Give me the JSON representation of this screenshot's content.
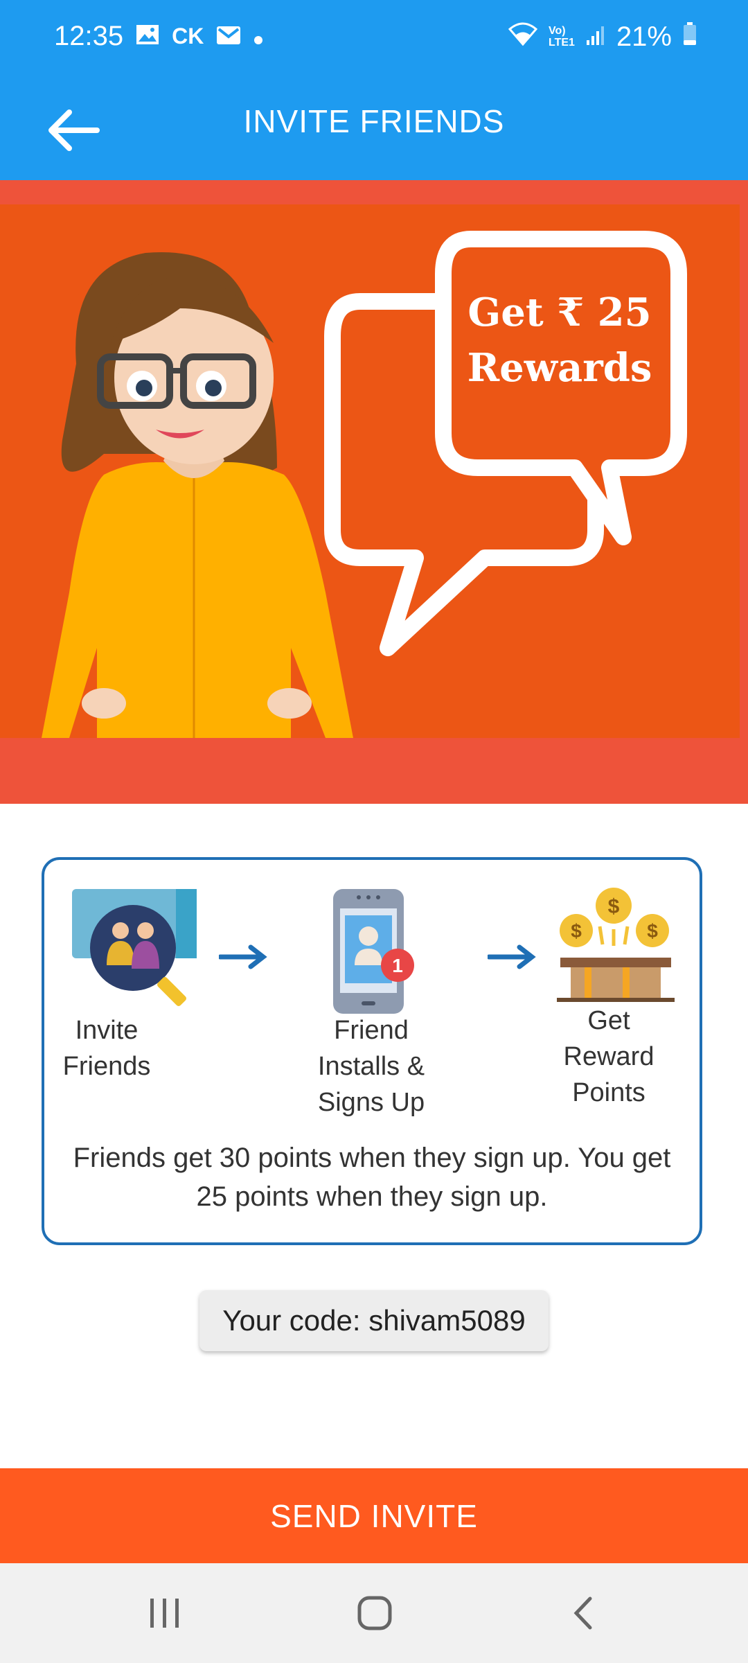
{
  "status_bar": {
    "time": "12:35",
    "carrier_text": "CK",
    "network_small_top": "Vo)",
    "network_small_bottom": "LTE1",
    "battery": "21%",
    "icons": [
      "image-icon",
      "gmail-icon",
      "dot-icon",
      "wifi-icon",
      "signal-icon",
      "battery-icon"
    ]
  },
  "appbar": {
    "title": "INVITE FRIENDS",
    "back_icon": "arrow-left-icon"
  },
  "banner": {
    "bubble_line1": "Get ₹ 25",
    "bubble_line2": "Rewards",
    "colors": {
      "outer": "#EE533A",
      "inner": "#EC5615"
    }
  },
  "steps": [
    {
      "label_line1": "Invite",
      "label_line2": "Friends",
      "icon": "invite-friends-icon"
    },
    {
      "label_line1": "Friend",
      "label_line2": "Installs &",
      "label_line3": "Signs Up",
      "icon": "phone-notification-icon"
    },
    {
      "label_line1": "Get",
      "label_line2": "Reward",
      "label_line3": "Points",
      "icon": "reward-chest-icon"
    }
  ],
  "description": "Friends get 30 points when they sign up. You get 25 points when they sign up.",
  "code_chip": "Your code: shivam5089",
  "send_button": "SEND INVITE",
  "accent_colors": {
    "appbar": "#1E9BF0",
    "button": "#FF5A1F",
    "card_border": "#1F6FB5"
  }
}
